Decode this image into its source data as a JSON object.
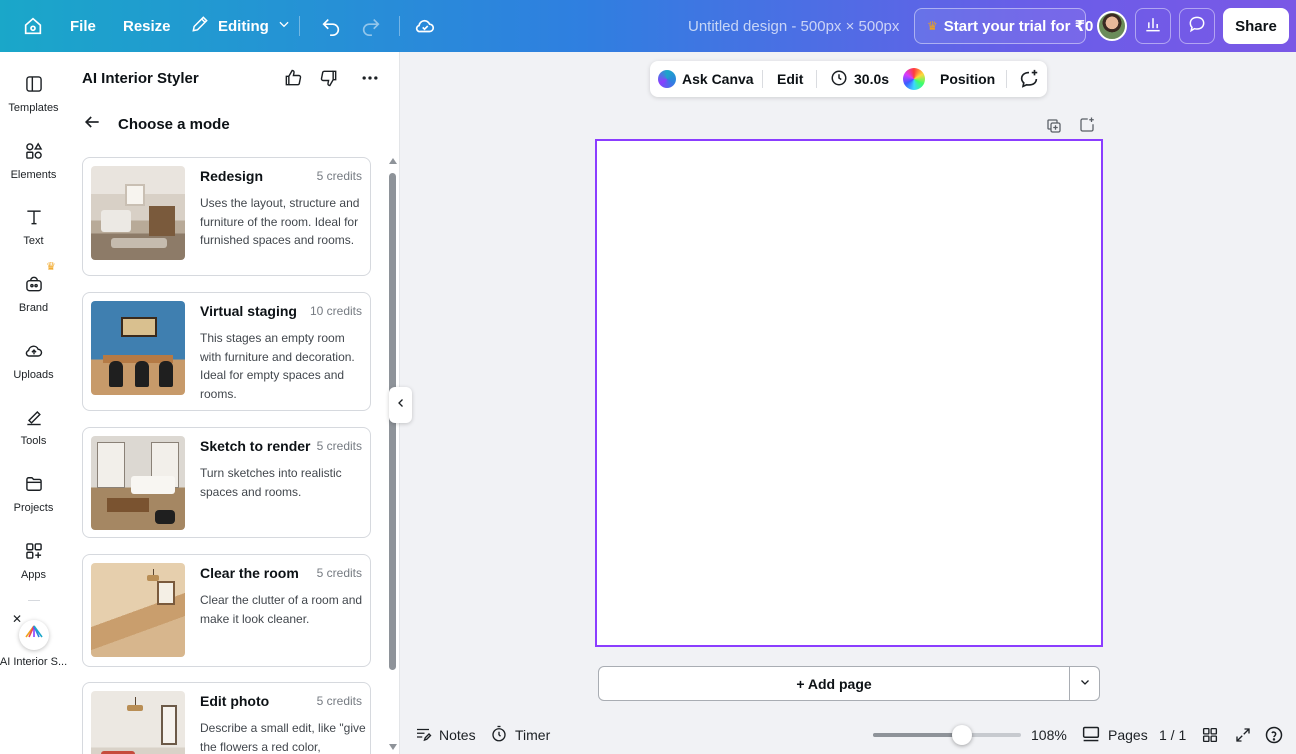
{
  "topbar": {
    "file_label": "File",
    "resize_label": "Resize",
    "editing_label": "Editing",
    "doc_title": "Untitled design - 500px × 500px",
    "trial_label": "Start your trial for ₹0",
    "share_label": "Share"
  },
  "rail": {
    "items": [
      {
        "label": "Templates",
        "icon": "templates-icon"
      },
      {
        "label": "Elements",
        "icon": "elements-icon"
      },
      {
        "label": "Text",
        "icon": "text-icon"
      },
      {
        "label": "Brand",
        "icon": "brand-icon"
      },
      {
        "label": "Uploads",
        "icon": "uploads-icon"
      },
      {
        "label": "Tools",
        "icon": "tools-icon"
      },
      {
        "label": "Projects",
        "icon": "projects-icon"
      },
      {
        "label": "Apps",
        "icon": "apps-icon"
      },
      {
        "label": "AI Interior S...",
        "icon": "ai-interior-styler-icon"
      }
    ]
  },
  "panel": {
    "title": "AI Interior Styler",
    "subheading": "Choose a mode",
    "cards": [
      {
        "title": "Redesign",
        "credits": "5 credits",
        "desc": "Uses the layout, structure and furniture of the room. Ideal for furnished spaces and rooms."
      },
      {
        "title": "Virtual staging",
        "credits": "10 credits",
        "desc": "This stages an empty room with furniture and decoration. Ideal for empty spaces and rooms."
      },
      {
        "title": "Sketch to render",
        "credits": "5 credits",
        "desc": "Turn sketches into realistic spaces and rooms."
      },
      {
        "title": "Clear the room",
        "credits": "5 credits",
        "desc": "Clear the clutter of a room and make it look cleaner."
      },
      {
        "title": "Edit photo",
        "credits": "5 credits",
        "desc": "Describe a small edit, like \"give the flowers a red color,"
      }
    ]
  },
  "context_toolbar": {
    "ask_canva": "Ask Canva",
    "edit": "Edit",
    "duration": "30.0s",
    "position": "Position"
  },
  "canvas": {
    "add_page": "+ Add page"
  },
  "bottombar": {
    "notes": "Notes",
    "timer": "Timer",
    "zoom": "108%",
    "zoom_fraction": 0.6,
    "pages": "Pages",
    "page_indicator": "1 / 1"
  },
  "colors": {
    "accent": "#8b3dff",
    "crown": "#f0a21a"
  }
}
